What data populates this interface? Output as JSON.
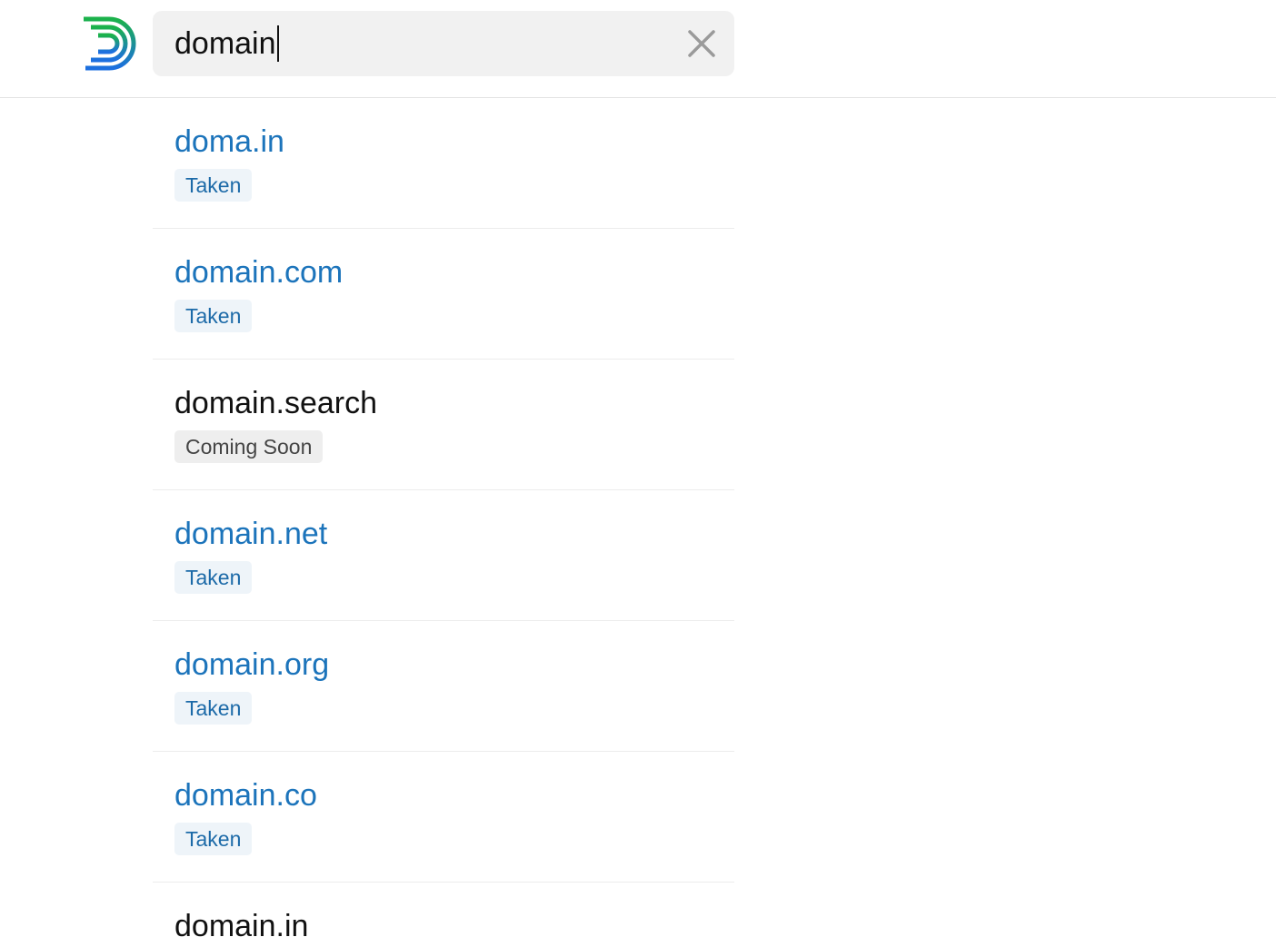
{
  "colors": {
    "link": "#1c74bb",
    "taken_bg": "#eef4f9",
    "soon_bg": "#eeeeee",
    "search_bg": "#f1f1f1"
  },
  "header": {
    "logo_icon": "domains-logo-icon",
    "search": {
      "value": "domain",
      "clear_icon": "close-icon"
    }
  },
  "results": [
    {
      "name": "doma.in",
      "status": "Taken",
      "style": "link"
    },
    {
      "name": "domain.com",
      "status": "Taken",
      "style": "link"
    },
    {
      "name": "domain.search",
      "status": "Coming Soon",
      "style": "plain"
    },
    {
      "name": "domain.net",
      "status": "Taken",
      "style": "link"
    },
    {
      "name": "domain.org",
      "status": "Taken",
      "style": "link"
    },
    {
      "name": "domain.co",
      "status": "Taken",
      "style": "link"
    }
  ],
  "partial_result": {
    "name": "domain.in"
  }
}
